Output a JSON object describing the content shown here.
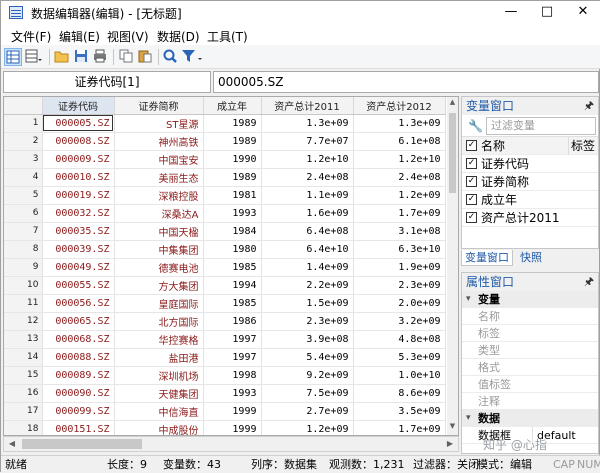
{
  "window": {
    "title": "数据编辑器(编辑) - [无标题]"
  },
  "menu": [
    "文件(F)",
    "编辑(E)",
    "视图(V)",
    "数据(D)",
    "工具(T)"
  ],
  "toolbar": {
    "icons": [
      "data-editor-icon",
      "open-folder-icon",
      "save-icon",
      "print-icon",
      "copy-icon",
      "paste-icon",
      "find-icon",
      "filter-icon"
    ]
  },
  "address": {
    "cell_name": "证券代码[1]",
    "cell_value": "000005.SZ"
  },
  "grid": {
    "columns": [
      "证券代码",
      "证券简称",
      "成立年",
      "资产总计2011",
      "资产总计2012"
    ],
    "rows": [
      {
        "n": "1",
        "code": "000005.SZ",
        "name": "ST星源",
        "year": "1989",
        "a2011": "1.3e+09",
        "a2012": "1.3e+09"
      },
      {
        "n": "2",
        "code": "000008.SZ",
        "name": "神州高铁",
        "year": "1989",
        "a2011": "7.7e+07",
        "a2012": "6.1e+08"
      },
      {
        "n": "3",
        "code": "000009.SZ",
        "name": "中国宝安",
        "year": "1990",
        "a2011": "1.2e+10",
        "a2012": "1.2e+10"
      },
      {
        "n": "4",
        "code": "000010.SZ",
        "name": "美丽生态",
        "year": "1989",
        "a2011": "2.4e+08",
        "a2012": "2.4e+08"
      },
      {
        "n": "5",
        "code": "000019.SZ",
        "name": "深粮控股",
        "year": "1981",
        "a2011": "1.1e+09",
        "a2012": "1.2e+09"
      },
      {
        "n": "6",
        "code": "000032.SZ",
        "name": "深桑达A",
        "year": "1993",
        "a2011": "1.6e+09",
        "a2012": "1.7e+09"
      },
      {
        "n": "7",
        "code": "000035.SZ",
        "name": "中国天楹",
        "year": "1984",
        "a2011": "6.4e+08",
        "a2012": "3.1e+08"
      },
      {
        "n": "8",
        "code": "000039.SZ",
        "name": "中集集团",
        "year": "1980",
        "a2011": "6.4e+10",
        "a2012": "6.3e+10"
      },
      {
        "n": "9",
        "code": "000049.SZ",
        "name": "德赛电池",
        "year": "1985",
        "a2011": "1.4e+09",
        "a2012": "1.9e+09"
      },
      {
        "n": "10",
        "code": "000055.SZ",
        "name": "方大集团",
        "year": "1994",
        "a2011": "2.2e+09",
        "a2012": "2.3e+09"
      },
      {
        "n": "11",
        "code": "000056.SZ",
        "name": "皇庭国际",
        "year": "1985",
        "a2011": "1.5e+09",
        "a2012": "2.0e+09"
      },
      {
        "n": "12",
        "code": "000065.SZ",
        "name": "北方国际",
        "year": "1986",
        "a2011": "2.3e+09",
        "a2012": "3.2e+09"
      },
      {
        "n": "13",
        "code": "000068.SZ",
        "name": "华控赛格",
        "year": "1997",
        "a2011": "3.9e+08",
        "a2012": "4.8e+08"
      },
      {
        "n": "14",
        "code": "000088.SZ",
        "name": "盐田港",
        "year": "1997",
        "a2011": "5.4e+09",
        "a2012": "5.3e+09"
      },
      {
        "n": "15",
        "code": "000089.SZ",
        "name": "深圳机场",
        "year": "1998",
        "a2011": "9.2e+09",
        "a2012": "1.0e+10"
      },
      {
        "n": "16",
        "code": "000090.SZ",
        "name": "天健集团",
        "year": "1993",
        "a2011": "7.5e+09",
        "a2012": "8.6e+09"
      },
      {
        "n": "17",
        "code": "000099.SZ",
        "name": "中信海直",
        "year": "1999",
        "a2011": "2.7e+09",
        "a2012": "3.5e+09"
      },
      {
        "n": "18",
        "code": "000151.SZ",
        "name": "中成股份",
        "year": "1999",
        "a2011": "1.2e+09",
        "a2012": "1.7e+09"
      }
    ]
  },
  "variables_panel": {
    "title": "变量窗口",
    "filter_placeholder": "过滤变量",
    "header_name": "名称",
    "header_label": "标签",
    "items": [
      "证券代码",
      "证券简称",
      "成立年",
      "资产总计2011"
    ],
    "tabs": [
      "变量窗口",
      "快照"
    ]
  },
  "properties_panel": {
    "title": "属性窗口",
    "var_category": "变量",
    "var_props": [
      "名称",
      "标签",
      "类型",
      "格式",
      "值标签",
      "注释"
    ],
    "data_category": "数据",
    "data_props": [
      {
        "k": "数据框",
        "v": "default"
      }
    ]
  },
  "status": {
    "ready": "就绪",
    "length": "长度：9",
    "vars": "变量数：43",
    "order": "列序：数据集",
    "obs": "观测数：1,231",
    "filter": "过滤器：关闭",
    "mode": "模式：编辑",
    "cap": "CAP",
    "num": "NUM"
  },
  "watermark": "知乎 @心指"
}
